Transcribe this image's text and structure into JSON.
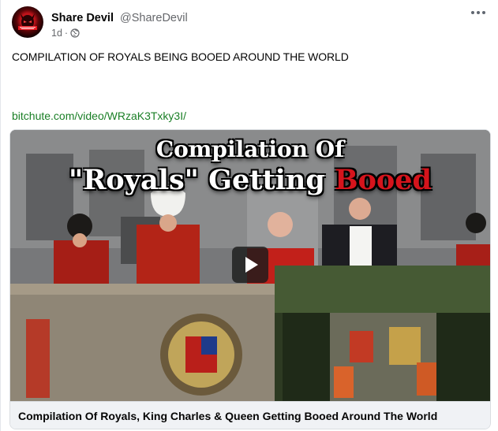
{
  "post": {
    "author_name": "Share Devil",
    "author_handle": "@ShareDevil",
    "timestamp": "1d",
    "separator": "·",
    "privacy_icon": "globe-icon",
    "text": "COMPILATION OF ROYALS BEING BOOED AROUND THE WORLD",
    "link_text": "bitchute.com/video/WRzaK3Txky3I/"
  },
  "link_card": {
    "thumbnail_title_line1": "Compilation Of",
    "thumbnail_title_line2_part1": "\"Royals\" Getting ",
    "thumbnail_title_line2_part2": "Booed",
    "play_icon": "play-icon",
    "caption": "Compilation Of Royals, King Charles & Queen Getting Booed Around The World"
  },
  "colors": {
    "link": "#1a7f26",
    "booed_red": "#d5141c",
    "caption_bg": "#f0f2f5"
  }
}
